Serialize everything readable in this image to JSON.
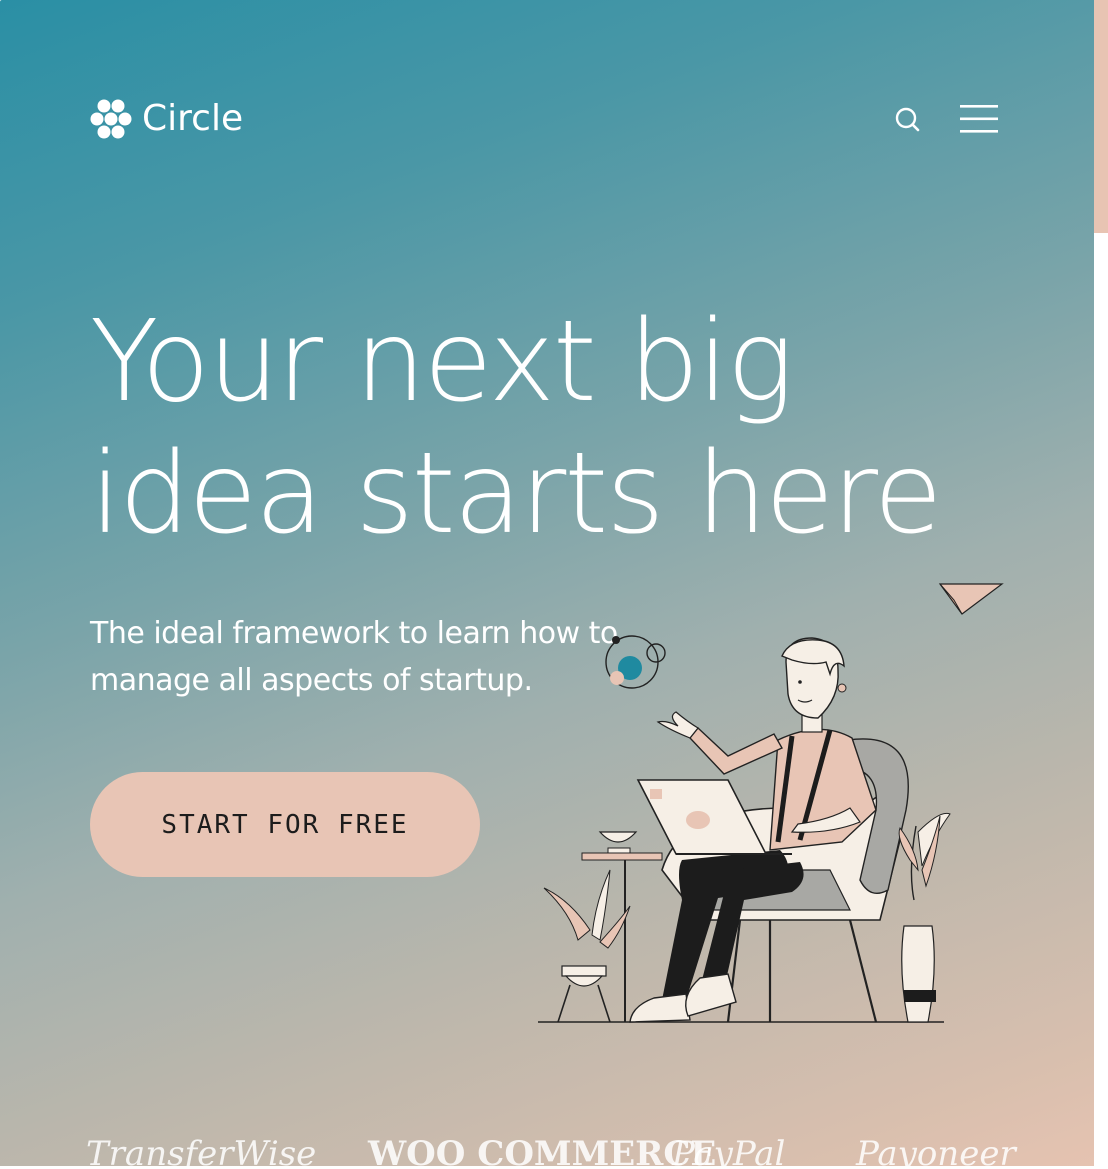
{
  "brand": {
    "name": "Circle"
  },
  "header": {
    "search_icon": "search-icon",
    "menu_icon": "hamburger-menu-icon"
  },
  "hero": {
    "title_line1": "Your next big",
    "title_line2": "idea starts here",
    "subtitle_line1": "The ideal framework to learn how to",
    "subtitle_line2": "manage all aspects of startup.",
    "cta_label": "START FOR FREE"
  },
  "partners": [
    "TransferWise",
    "WOO COMMERCE",
    "PayPal",
    "Payoneer"
  ],
  "colors": {
    "gradient_start": "#2a8fa5",
    "gradient_end": "#e6c3b1",
    "accent": "#e8c5b5",
    "text_light": "#ffffff",
    "text_dark": "#1c1c1c"
  }
}
